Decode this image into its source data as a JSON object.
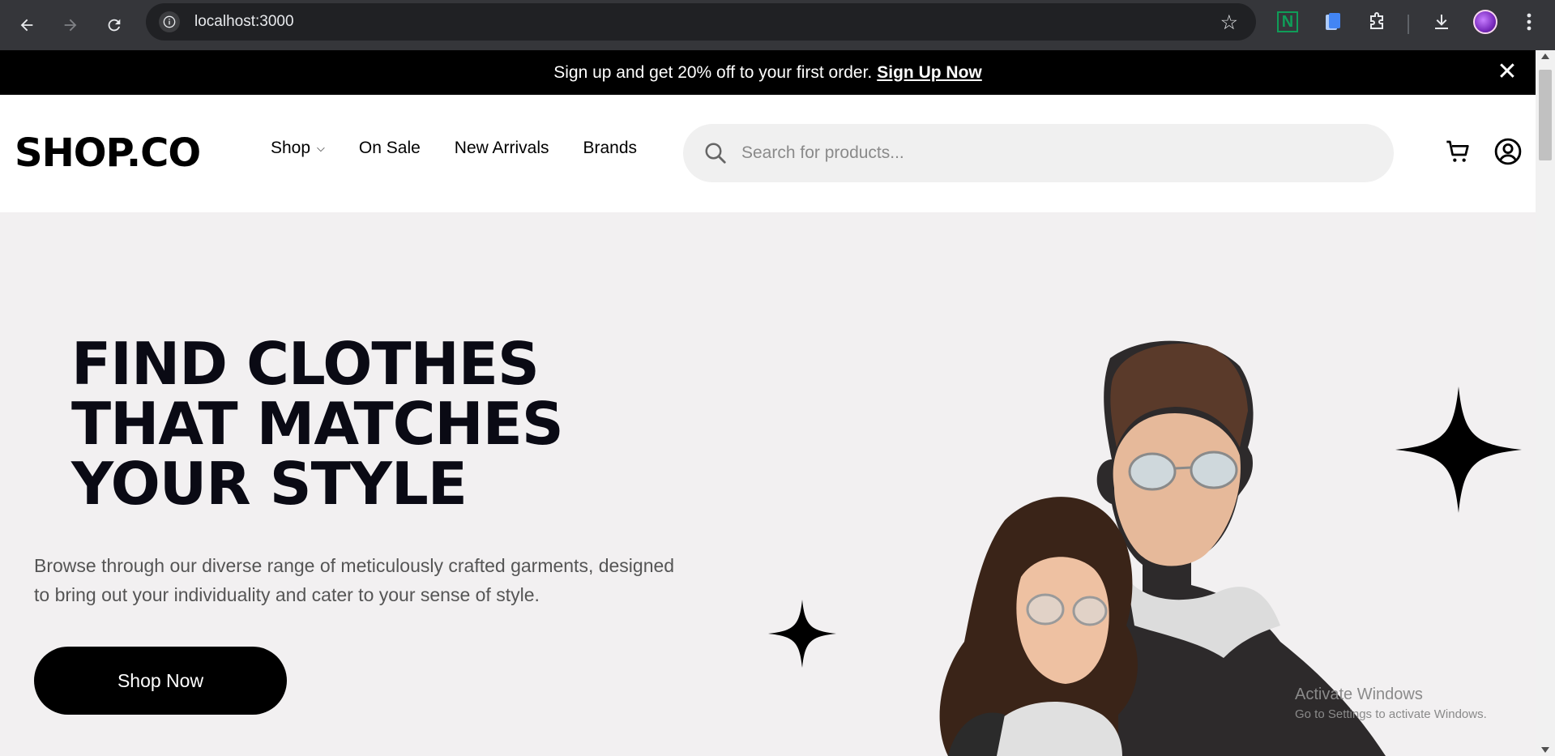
{
  "browser": {
    "url": "localhost:3000",
    "back_icon": "arrow-left-icon",
    "forward_icon": "arrow-right-icon",
    "reload_icon": "reload-icon",
    "extensions": [
      "n-extension-icon",
      "docs-extension-icon",
      "puzzle-icon",
      "download-icon",
      "profile-avatar",
      "kebab-menu-icon"
    ]
  },
  "promo": {
    "text": "Sign up and get 20% off to your first order.",
    "link": "Sign Up Now"
  },
  "header": {
    "logo": "SHOP.CO",
    "nav": [
      {
        "label": "Shop",
        "has_dropdown": true
      },
      {
        "label": "On Sale"
      },
      {
        "label": "New Arrivals"
      },
      {
        "label": "Brands"
      }
    ],
    "search_placeholder": "Search for products..."
  },
  "hero": {
    "title_lines": [
      "FIND CLOTHES",
      "THAT MATCHES",
      "YOUR STYLE"
    ],
    "description_line1": "Browse through our diverse range of meticulously crafted garments, designed",
    "description_line2": "to bring out your individuality and cater to your sense of style.",
    "cta": "Shop Now"
  },
  "watermark": {
    "title": "Activate Windows",
    "subtitle": "Go to Settings to activate Windows."
  },
  "colors": {
    "promo_bg": "#000000",
    "hero_bg": "#f2f0f1",
    "chrome_bg": "#35363a",
    "button_bg": "#000000"
  }
}
